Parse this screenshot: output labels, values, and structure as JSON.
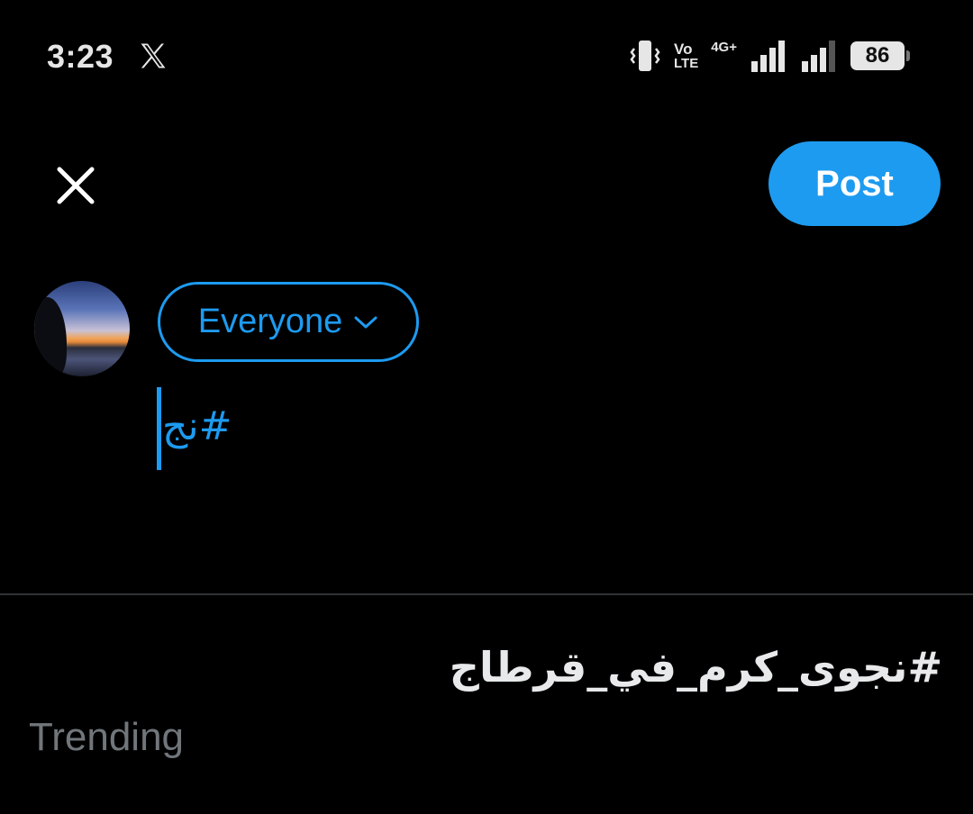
{
  "status_bar": {
    "time": "3:23",
    "app_icon": "x-logo-icon",
    "vibrate_icon": "vibrate-icon",
    "volte_line1": "Vo",
    "volte_line2": "LTE",
    "network_type": "4G+",
    "battery_level": "86",
    "signal_icon": "signal-icon"
  },
  "header": {
    "close_icon": "close-icon",
    "post_label": "Post"
  },
  "composer": {
    "audience_label": "Everyone",
    "audience_chevron_icon": "chevron-down-icon",
    "text": "#نج"
  },
  "suggestion": {
    "hashtag": "#نجوى_كرم_في_قرطاج",
    "subtitle": "Trending"
  },
  "colors": {
    "accent": "#1d9bf0",
    "background": "#000000",
    "divider": "#2f3336",
    "secondary_text": "#71767b"
  }
}
